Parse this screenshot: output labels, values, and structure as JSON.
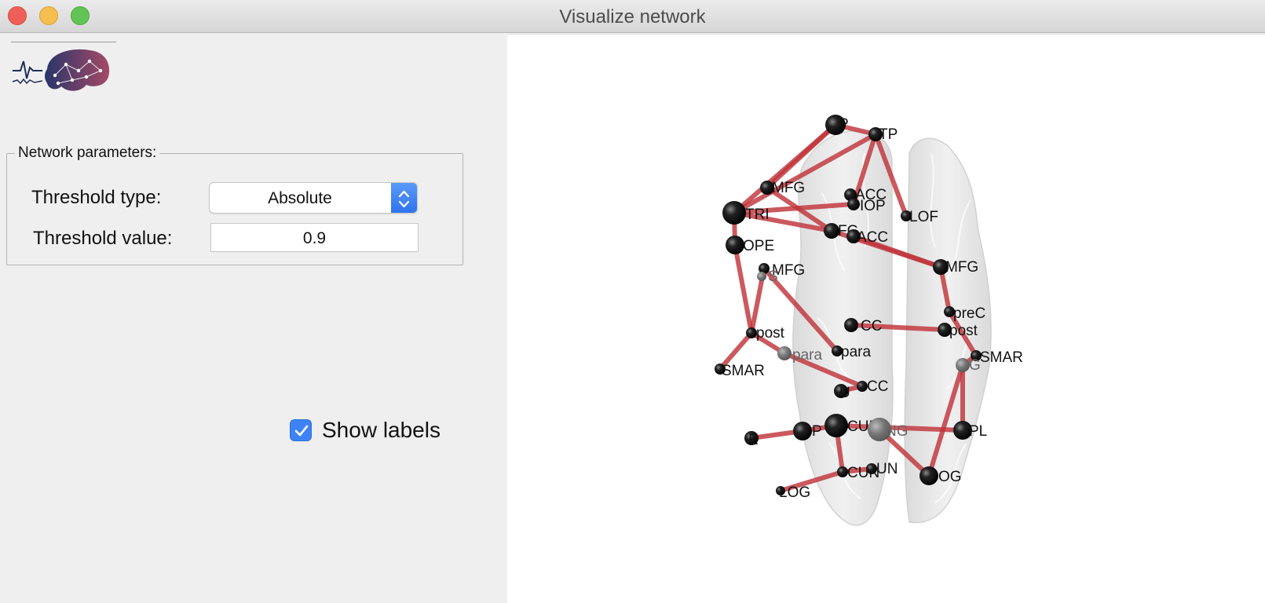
{
  "window": {
    "title": "Visualize network"
  },
  "network_parameters": {
    "group_title": "Network parameters:",
    "threshold_type": {
      "label": "Threshold type:",
      "value": "Absolute"
    },
    "threshold_value": {
      "label": "Threshold value:",
      "value": "0.9"
    }
  },
  "show_labels": {
    "label": "Show labels",
    "checked": true
  },
  "colors": {
    "edge": "#c0353a",
    "node": "#000000",
    "accent": "#3e83f6"
  },
  "brain_plot": {
    "nodes": [
      {
        "label": "P"
      },
      {
        "label": "TP"
      },
      {
        "label": "MFG"
      },
      {
        "label": "TRI"
      },
      {
        "label": "ACC"
      },
      {
        "label": "IOP"
      },
      {
        "label": "LOF"
      },
      {
        "label": "FG"
      },
      {
        "label": "ACC"
      },
      {
        "label": "OPE"
      },
      {
        "label": "MFG"
      },
      {
        "label": "MFG"
      },
      {
        "label": "S"
      },
      {
        "label": "preC"
      },
      {
        "label": "post"
      },
      {
        "label": "post"
      },
      {
        "label": "CC"
      },
      {
        "label": "para"
      },
      {
        "label": "para"
      },
      {
        "label": "SMAR"
      },
      {
        "label": "SMAR"
      },
      {
        "label": "G"
      },
      {
        "label": "CC"
      },
      {
        "label": "U"
      },
      {
        "label": "E"
      },
      {
        "label": "P"
      },
      {
        "label": "CUN"
      },
      {
        "label": "NG"
      },
      {
        "label": "PL"
      },
      {
        "label": "OG"
      },
      {
        "label": "CUN"
      },
      {
        "label": "UN"
      },
      {
        "label": "LOG"
      }
    ]
  }
}
